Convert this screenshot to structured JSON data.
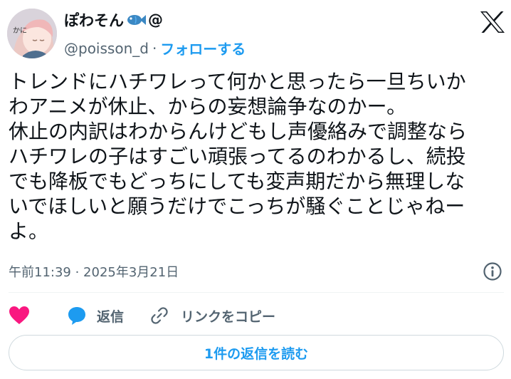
{
  "author": {
    "display_name": "ぽわそん",
    "display_suffix": "@",
    "handle": "@poisson_d",
    "separator": "·",
    "follow_label": "フォローする",
    "avatar_text": "かに"
  },
  "tweet": {
    "lines": [
      "トレンドにハチワレって何かと思ったら一旦ちいか",
      "わアニメが休止、からの妄想論争なのかー。",
      "休止の内訳はわからんけどもし声優絡みで調整なら",
      "ハチワレの子はすごい頑張ってるのわかるし、続投",
      "でも降板でもどっちにしても変声期だから無理しな",
      "いでほしいと願うだけでこっちが騒ぐことじゃねー",
      "よ。"
    ]
  },
  "meta": {
    "timestamp": "午前11:39 · 2025年3月21日"
  },
  "actions": {
    "reply_label": "返信",
    "copy_link_label": "リンクをコピー"
  },
  "read_replies_label": "1件の返信を読む",
  "colors": {
    "accent": "#1d9bf0",
    "like": "#f91880",
    "text": "#0f1419",
    "secondary": "#536471"
  }
}
